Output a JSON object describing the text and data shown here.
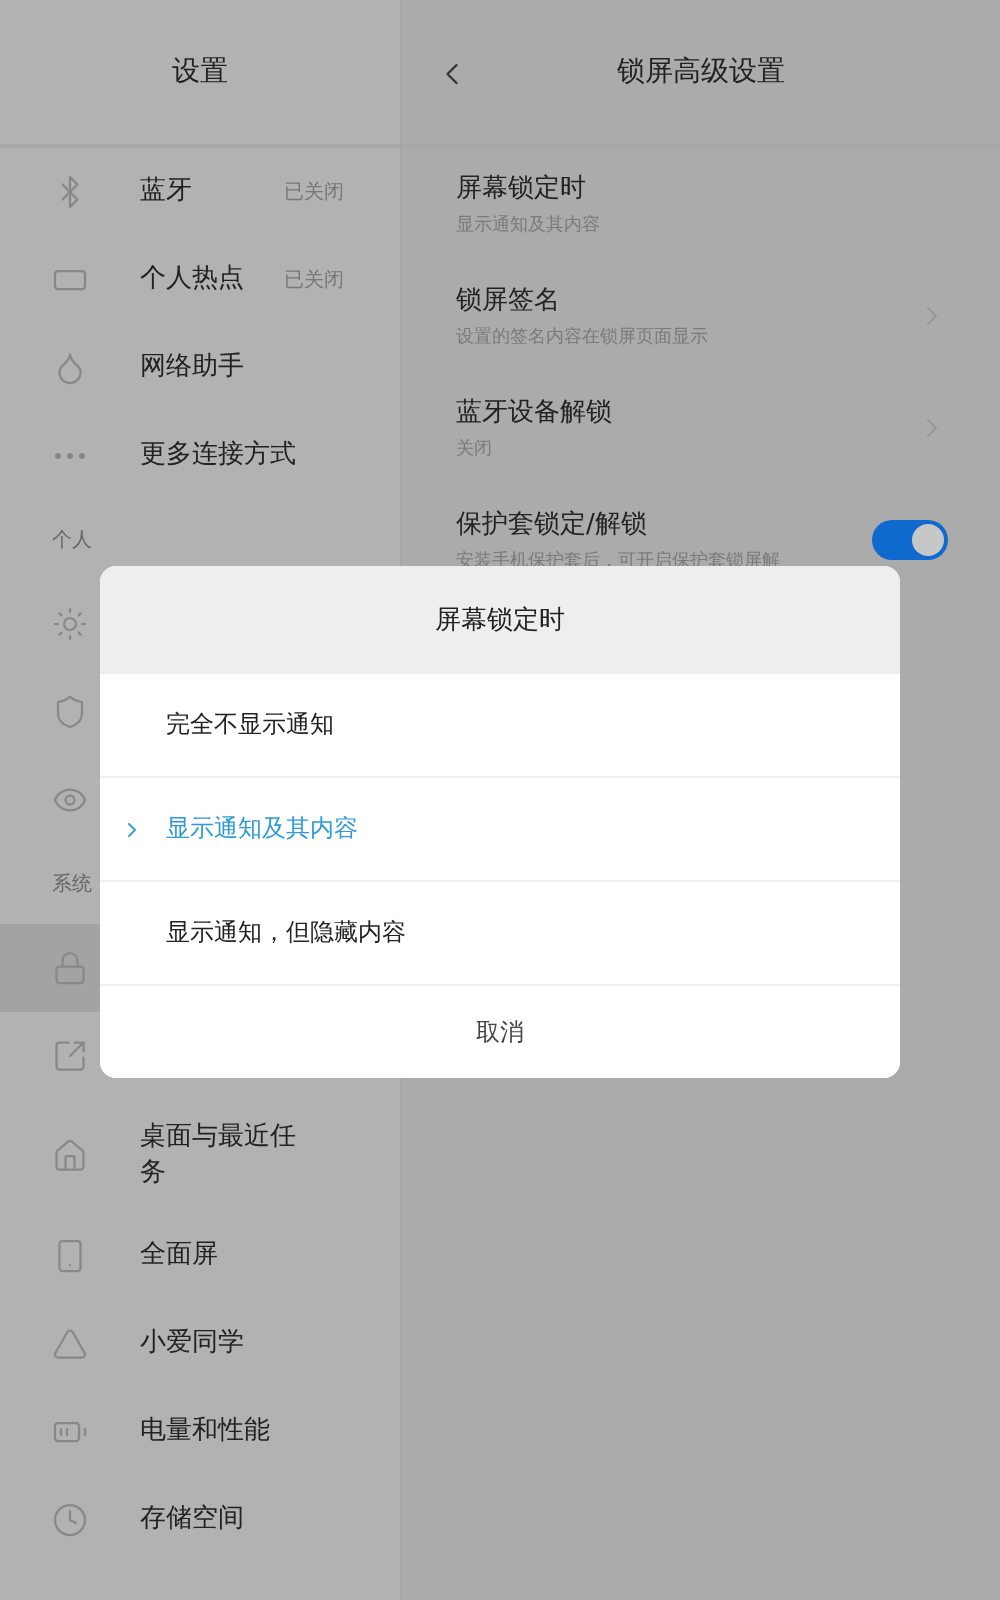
{
  "sidebar": {
    "title": "设置",
    "items": [
      {
        "kind": "entry",
        "label": "蓝牙",
        "status": "已关闭",
        "selected": false
      },
      {
        "kind": "entry",
        "label": "个人热点",
        "status": "已关闭",
        "selected": false
      },
      {
        "kind": "entry",
        "label": "网络助手",
        "selected": false
      },
      {
        "kind": "entry",
        "label": "更多连接方式",
        "selected": false
      },
      {
        "kind": "section",
        "label": "个人"
      },
      {
        "kind": "entry",
        "selected": false
      },
      {
        "kind": "entry",
        "selected": false
      },
      {
        "kind": "entry",
        "selected": false
      },
      {
        "kind": "section",
        "label": "系统"
      },
      {
        "kind": "entry",
        "selected": true
      },
      {
        "kind": "entry",
        "selected": false
      },
      {
        "kind": "entry",
        "label": "桌面与最近任务",
        "selected": false
      },
      {
        "kind": "entry",
        "label": "全面屏",
        "selected": false
      },
      {
        "kind": "entry",
        "label": "小爱同学",
        "selected": false
      },
      {
        "kind": "entry",
        "label": "电量和性能",
        "selected": false
      },
      {
        "kind": "entry",
        "label": "存储空间",
        "selected": false
      }
    ]
  },
  "detail": {
    "title": "锁屏高级设置",
    "settings": [
      {
        "kind": "plain",
        "title": "屏幕锁定时",
        "subtitle": "显示通知及其内容"
      },
      {
        "kind": "link",
        "title": "锁屏签名",
        "subtitle": "设置的签名内容在锁屏页面显示"
      },
      {
        "kind": "link",
        "title": "蓝牙设备解锁",
        "subtitle": "关闭"
      },
      {
        "kind": "switch",
        "title": "保护套锁定/解锁",
        "subtitle": "安装手机保护套后，可开启保护套锁屏解",
        "on": true
      }
    ]
  },
  "dialog": {
    "title": "屏幕锁定时",
    "options": [
      {
        "label": "完全不显示通知",
        "selected": false
      },
      {
        "label": "显示通知及其内容",
        "selected": true
      },
      {
        "label": "显示通知，但隐藏内容",
        "selected": false
      }
    ],
    "cancel": "取消"
  }
}
